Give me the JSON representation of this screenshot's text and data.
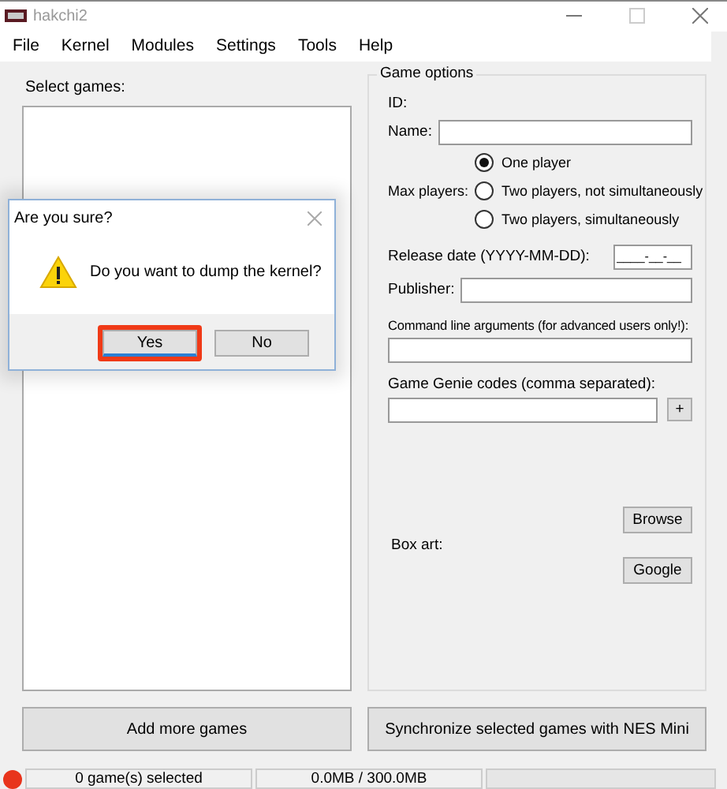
{
  "window": {
    "title": "hakchi2"
  },
  "menu": [
    "File",
    "Kernel",
    "Modules",
    "Settings",
    "Tools",
    "Help"
  ],
  "games_panel": {
    "label": "Select games:"
  },
  "game_options": {
    "title": "Game options",
    "id_label": "ID:",
    "name_label": "Name:",
    "max_players_label": "Max players:",
    "player_options": [
      {
        "label": "One player",
        "selected": true
      },
      {
        "label": "Two players, not simultaneously",
        "selected": false
      },
      {
        "label": "Two players, simultaneously",
        "selected": false
      }
    ],
    "release_date_label": "Release date (YYYY-MM-DD):",
    "release_date_value": "____-__-__",
    "publisher_label": "Publisher:",
    "command_line_label": "Command line arguments (for advanced users only!):",
    "game_genie_label": "Game Genie codes (comma separated):",
    "add_code_button": "+",
    "browse_button": "Browse",
    "box_art_label": "Box art:",
    "google_button": "Google"
  },
  "buttons": [
    "Add more games",
    "Synchronize selected games with NES Mini"
  ],
  "status_bar": [
    "0 game(s) selected",
    "0.0MB / 300.0MB"
  ],
  "dialog": {
    "title": "Are you sure?",
    "message": "Do you want to dump the kernel?",
    "buttons": [
      {
        "label": "Yes",
        "highlighted": true
      },
      {
        "label": "No",
        "highlighted": false
      }
    ]
  }
}
